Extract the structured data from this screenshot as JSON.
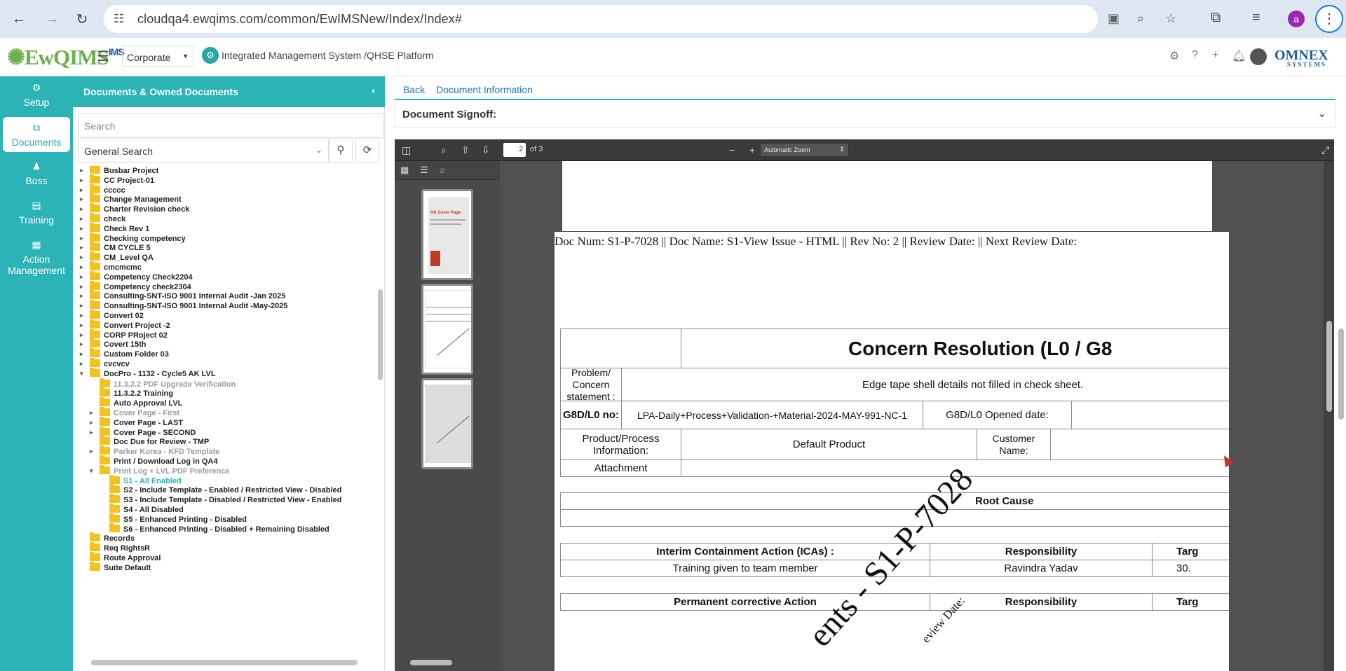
{
  "browser": {
    "url": "cloudqa4.ewqims.com/common/EwIMSNew/Index/Index#",
    "avatar_letter": "a"
  },
  "header": {
    "logo": "EwQIMS",
    "logo_sup": "IMS",
    "entity": "Corporate",
    "platform": "Integrated Management System /QHSE Platform",
    "company": "OMNEX",
    "company_sub": "SYSTEMS"
  },
  "sidebar": {
    "items": [
      {
        "icon": "gear-icon",
        "label": "Setup"
      },
      {
        "icon": "documents-icon",
        "label": "Documents"
      },
      {
        "icon": "person-icon",
        "label": "Boss"
      },
      {
        "icon": "training-icon",
        "label": "Training"
      },
      {
        "icon": "building-icon",
        "label": "Action Management"
      }
    ]
  },
  "tree": {
    "title": "Documents & Owned Documents",
    "search_placeholder": "Search",
    "search_type": "General Search",
    "items": [
      "Busbar Project",
      "CC Project-01",
      "ccccc",
      "Change Management",
      "Charter Revision check",
      "check",
      "Check Rev 1",
      "Checking competency",
      "CM CYCLE 5",
      "CM_Level QA",
      "cmcmcmc",
      "Competency Check2204",
      "Competency check2304",
      "Consulting-SNT-ISO 9001 Internal Audit -Jan 2025",
      "Consulting-SNT-ISO 9001 Internal Audit -May-2025",
      "Convert 02",
      "Convert Project -2",
      "CORP PRoject 02",
      "Covert 15th",
      "Custom Folder 03",
      "cvcvcv",
      "DocPro - 1132 - Cycle5 AK LVL",
      "11.3.2.2 PDF Upgrade Verification",
      "11.3.2.2 Training",
      "Auto Approval LVL",
      "Cover Page - First",
      "Cover Page - LAST",
      "Cover Page - SECOND",
      "Doc Due for Review - TMP",
      "Parker Korea - KFD Template",
      "Print / Download Log in QA4",
      "Print Log + LVL PDF Preference",
      "S1 - All Enabled",
      "S2 - Include Template - Enabled / Restricted View - Disabled",
      "S3 - Include Template - Disabled / Restricted View - Enabled",
      "S4 - All Disabled",
      "S5 - Enhanced Printing - Disabled",
      "S6 - Enhanced Printing - Disabled + Remaining Disabled",
      "Records",
      "Req RightsR",
      "Route Approval",
      "Suite Default"
    ]
  },
  "main": {
    "back": "Back",
    "doc_info": "Document Information",
    "signoff_title": "Document Signoff:"
  },
  "viewer": {
    "page": "2",
    "of_pages": "of 3",
    "zoom": "Automatic Zoom"
  },
  "thumbnails": {
    "cover_title": "AK Cover Page"
  },
  "document": {
    "header_line": "Doc Num: S1-P-7028 || Doc Name: S1-View Issue - HTML || Rev No: 2 || Review Date:  || Next Review Date:",
    "title": "Concern Resolution (L0 / G8",
    "problem_label": "Problem/ Concern statement :",
    "problem_value": "Edge tape shell details not filled in check sheet.",
    "g8d_label": "G8D/L0 no:",
    "g8d_value": "LPA-Daily+Process+Validation-+Material-2024-MAY-991-NC-1",
    "opened_label": "G8D/L0 Opened date:",
    "product_label": "Product/Process Information:",
    "product_value": "Default Product",
    "customer_label": "Customer Name:",
    "attachment_label": "Attachment",
    "root_cause": "Root Cause",
    "ica_label": "Interim Containment Action (ICAs) :",
    "responsibility": "Responsibility",
    "target": "Targ",
    "ica_value": "Training given to team member",
    "resp_value": "Ravindra Yadav",
    "target_value": "30.",
    "pca_label": "Permanent corrective Action",
    "watermark": "ents - S1-P-7028",
    "watermark2": "eview Date:"
  }
}
